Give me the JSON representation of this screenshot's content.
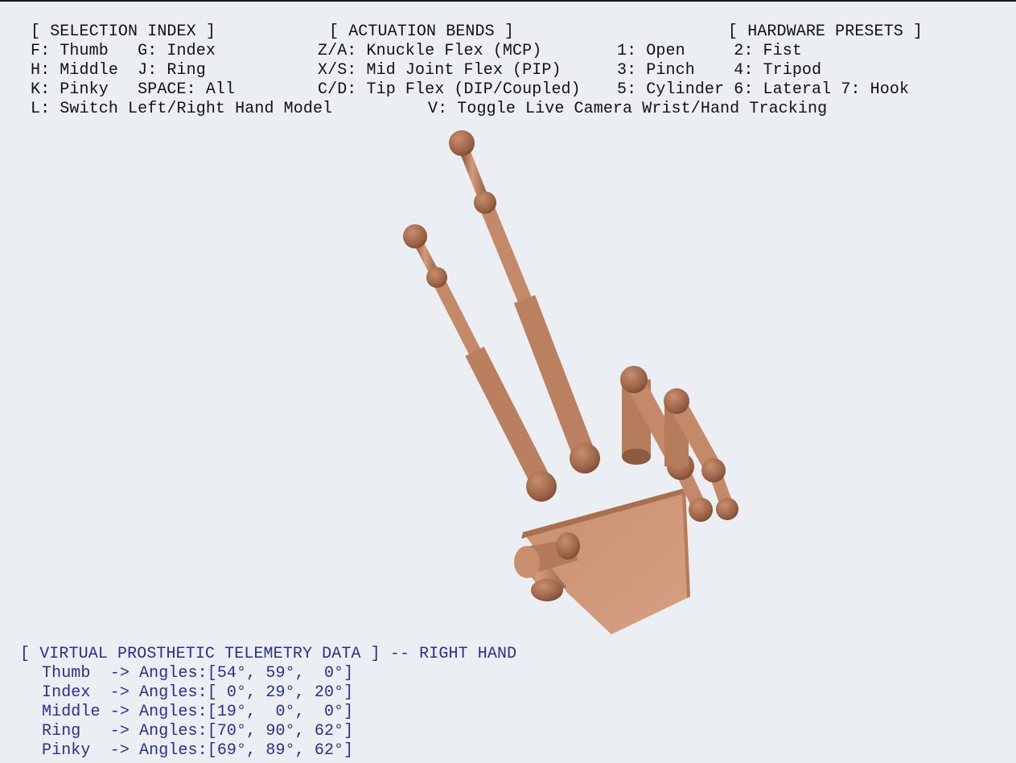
{
  "controls": {
    "selection_header": "[ SELECTION INDEX ]",
    "actuation_header": "[ ACTUATION BENDS ]",
    "presets_header": "[ HARDWARE PRESETS ]",
    "row1": {
      "left": "F: Thumb   G: Index",
      "mid": "Z/A: Knuckle Flex (MCP)",
      "right": "1: Open     2: Fist"
    },
    "row2": {
      "left": "H: Middle  J: Ring",
      "mid": "X/S: Mid Joint Flex (PIP)",
      "right": "3: Pinch    4: Tripod"
    },
    "row3": {
      "left": "K: Pinky   SPACE: All",
      "mid": "C/D: Tip Flex (DIP/Coupled)",
      "right": "5: Cylinder 6: Lateral 7: Hook"
    },
    "row4": {
      "left": "L: Switch Left/Right Hand Model",
      "right": "V: Toggle Live Camera Wrist/Hand Tracking"
    }
  },
  "telemetry": {
    "header": "[ VIRTUAL PROSTHETIC TELEMETRY DATA ] -- RIGHT HAND",
    "rows": [
      "Thumb  -> Angles:[54°, 59°,  0°]",
      "Index  -> Angles:[ 0°, 29°, 20°]",
      "Middle -> Angles:[19°,  0°,  0°]",
      "Ring   -> Angles:[70°, 90°, 62°]",
      "Pinky  -> Angles:[69°, 89°, 62°]"
    ]
  },
  "colors": {
    "background": "#ebeef3",
    "text_controls": "#111111",
    "text_telemetry": "#2a2f8c",
    "skin_base": "#c98a6a",
    "skin_dark": "#8f5a40",
    "skin_light": "#dca788",
    "palm": "#d19a7c"
  }
}
